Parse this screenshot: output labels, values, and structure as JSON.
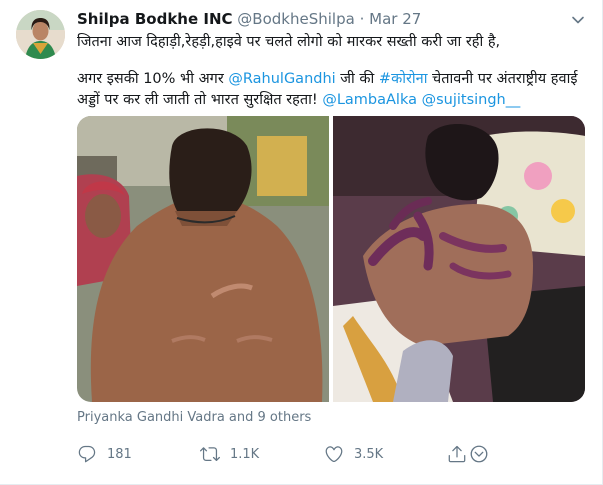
{
  "tweet": {
    "author_name": "Shilpa Bodkhe INC",
    "handle": "@BodkheShilpa",
    "separator": "·",
    "date": "Mar 27",
    "line1": "जितना आज दिहाड़ी,रेहड़ी,हाइवे पर चलते लोगो को मारकर सख्ती करी जा रही है,",
    "line2_a": "अगर इसकी 10% भी अगर ",
    "mention_rahul": "@RahulGandhi",
    "line2_b": " जी की ",
    "hashtag": "#कोरोना",
    "line2_c": " चेतावनी पर अंतराष्ट्रीय हवाई अड्डों पर कर ली जाती तो भारत सुरक्षित रहता! ",
    "mention_lamba": "@LambaAlka",
    "line2_space": " ",
    "mention_sujit": "@sujitsingh__",
    "tagged_people": "Priyanka Gandhi Vadra and 9 others"
  },
  "actions": {
    "reply_count": "181",
    "retweet_count": "1.1K",
    "like_count": "3.5K"
  },
  "icons": {
    "caret": "chevron-down-icon",
    "reply": "reply-icon",
    "retweet": "retweet-icon",
    "like": "heart-icon",
    "share": "share-icon"
  },
  "colors": {
    "link": "#1b95e0",
    "secondary_text": "#657786",
    "primary_text": "#14171a"
  }
}
